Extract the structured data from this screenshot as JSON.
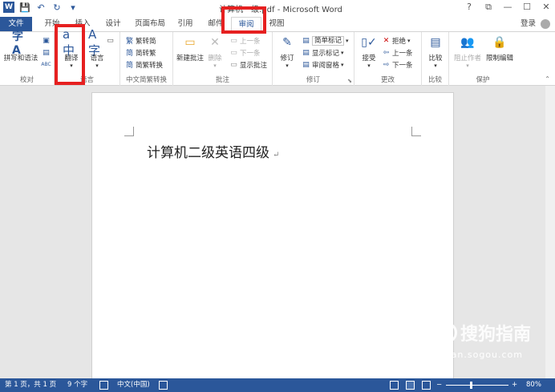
{
  "window": {
    "title": "计算机一级.pdf - Microsoft Word",
    "controls": [
      "?",
      "⧉",
      "—",
      "☐",
      "✕"
    ]
  },
  "tabs": {
    "file": "文件",
    "items": [
      "开始",
      "插入",
      "设计",
      "页面布局",
      "引用",
      "邮件",
      "审阅",
      "视图"
    ],
    "active": "审阅",
    "login": "登录"
  },
  "ribbon": {
    "proofing": {
      "spelling": "拼写和语法",
      "label": "校对"
    },
    "language": {
      "translate": "翻译",
      "language": "语言",
      "label": "语言"
    },
    "chinese": {
      "trad_to_simp": "繁转简",
      "simp_to_trad": "简转繁",
      "convert": "简繁转换",
      "label": "中文简繁转换"
    },
    "comments": {
      "new_comment": "新建批注",
      "delete": "删除",
      "previous": "上一条",
      "next": "下一条",
      "show_comments": "显示批注",
      "label": "批注"
    },
    "tracking": {
      "track_changes": "修订",
      "markup_select": "简单标记",
      "show_markup": "显示标记",
      "reviewing_pane": "审阅窗格",
      "label": "修订"
    },
    "changes": {
      "accept": "接受",
      "reject": "拒绝",
      "previous": "上一条",
      "next": "下一条",
      "label": "更改"
    },
    "compare": {
      "compare": "比较",
      "label": "比较"
    },
    "protect": {
      "block_authors": "阻止作者",
      "restrict_editing": "限制编辑",
      "label": "保护"
    }
  },
  "document": {
    "text": "计算机二级英语四级",
    "para_mark": "↵"
  },
  "watermark": {
    "brand": "搜狗指南",
    "url": "zhinan.sogou.com"
  },
  "statusbar": {
    "page": "第 1 页，共 1 页",
    "words": "9 个字",
    "language": "中文(中国)",
    "zoom": "80%",
    "zoom_fraction": 0.8
  },
  "colors": {
    "accent": "#2b579a",
    "annotation": "#e62020"
  }
}
